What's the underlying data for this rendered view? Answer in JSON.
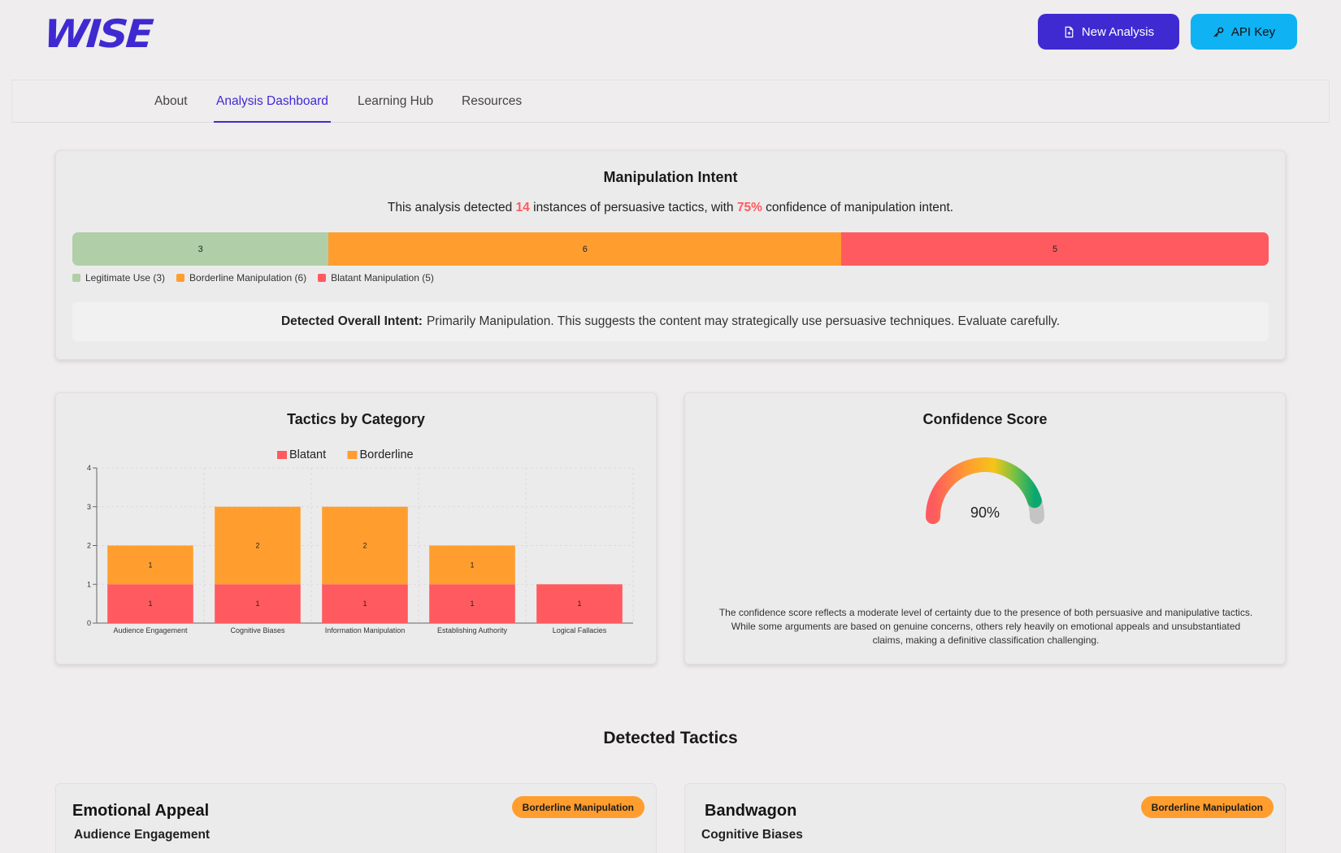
{
  "header": {
    "logo": "WISE",
    "new_analysis_label": "New Analysis",
    "api_key_label": "API Key",
    "new_analysis_icon": "file-plus-icon",
    "api_key_icon": "key-icon"
  },
  "nav": {
    "tabs": [
      {
        "label": "About"
      },
      {
        "label": "Analysis Dashboard",
        "active": true
      },
      {
        "label": "Learning Hub"
      },
      {
        "label": "Resources"
      }
    ]
  },
  "intent": {
    "title": "Manipulation Intent",
    "summary_pre": "This analysis detected ",
    "instances": "14",
    "summary_mid": " instances of persuasive tactics, with ",
    "confidence": "75%",
    "summary_post": " confidence of manipulation intent.",
    "segments": [
      {
        "label": "3",
        "value": 3,
        "color": "#b0cfa8"
      },
      {
        "label": "6",
        "value": 6,
        "color": "#ff9e2f"
      },
      {
        "label": "5",
        "value": 5,
        "color": "#ff5a5f"
      }
    ],
    "legend": [
      {
        "label": "Legitimate Use (3)",
        "color": "#b0cfa8"
      },
      {
        "label": "Borderline Manipulation (6)",
        "color": "#ff9e2f"
      },
      {
        "label": "Blatant Manipulation (5)",
        "color": "#ff5a5f"
      }
    ],
    "overall_label": "Detected Overall Intent:",
    "overall_text": "Primarily Manipulation. This suggests the content may strategically use persuasive techniques. Evaluate carefully."
  },
  "tactics_chart": {
    "title": "Tactics by Category"
  },
  "chart_data": {
    "type": "bar",
    "stacked": true,
    "title": "Tactics by Category",
    "categories": [
      "Audience Engagement",
      "Cognitive Biases",
      "Information Manipulation",
      "Establishing Authority",
      "Logical Fallacies"
    ],
    "series": [
      {
        "name": "Blatant",
        "values": [
          1,
          1,
          1,
          1,
          1
        ],
        "color": "#ff5a5f"
      },
      {
        "name": "Borderline",
        "values": [
          1,
          2,
          2,
          1,
          0
        ],
        "color": "#ff9e2f"
      }
    ],
    "yticks": [
      "0",
      "1",
      "2",
      "3",
      "4"
    ],
    "ylim": [
      0,
      4
    ],
    "grid": true,
    "legend": "top"
  },
  "confidence": {
    "title": "Confidence Score",
    "value": 0.9,
    "label": "90%",
    "description": "The confidence score reflects a moderate level of certainty due to the presence of both persuasive and manipulative tactics. While some arguments are based on genuine concerns, others rely heavily on emotional appeals and unsubstantiated claims, making a definitive classification challenging."
  },
  "detected": {
    "title": "Detected Tactics",
    "items": [
      {
        "name": "Emotional Appeal",
        "category": "Audience Engagement",
        "badge": "Borderline Manipulation"
      },
      {
        "name": "Bandwagon",
        "category": "Cognitive Biases",
        "badge": "Borderline Manipulation"
      }
    ]
  }
}
